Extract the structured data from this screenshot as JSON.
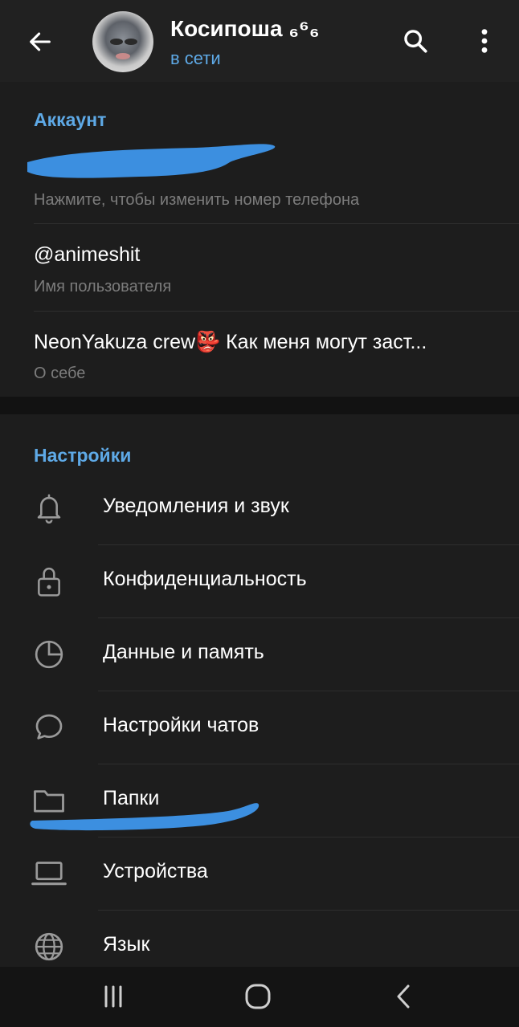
{
  "header": {
    "back_icon": "arrow-left-icon",
    "contact_name": "Косипоша ₆⁶₆",
    "status": "в сети",
    "search_icon": "search-icon",
    "more_icon": "more-vertical-icon"
  },
  "account": {
    "title": "Аккаунт",
    "phone_hint": "Нажмите, чтобы изменить номер телефона",
    "username": "@animeshit",
    "username_hint": "Имя пользователя",
    "bio": "NeonYakuza crew👺 Как меня могут заст...",
    "bio_hint": "О себе"
  },
  "settings": {
    "title": "Настройки",
    "items": [
      {
        "label": "Уведомления и звук",
        "icon": "bell-icon"
      },
      {
        "label": "Конфиденциальность",
        "icon": "lock-icon"
      },
      {
        "label": "Данные и память",
        "icon": "pie-chart-icon"
      },
      {
        "label": "Настройки чатов",
        "icon": "chat-bubble-icon"
      },
      {
        "label": "Папки",
        "icon": "folder-icon"
      },
      {
        "label": "Устройства",
        "icon": "laptop-icon"
      },
      {
        "label": "Язык",
        "icon": "globe-icon"
      }
    ]
  },
  "navbar": {
    "recents_icon": "recents-icon",
    "home_icon": "home-icon",
    "back_icon": "nav-back-icon"
  },
  "colors": {
    "accent": "#5ea9e6",
    "background": "#1d1d1d",
    "header": "#212121",
    "scribble": "#3c8fe0"
  }
}
